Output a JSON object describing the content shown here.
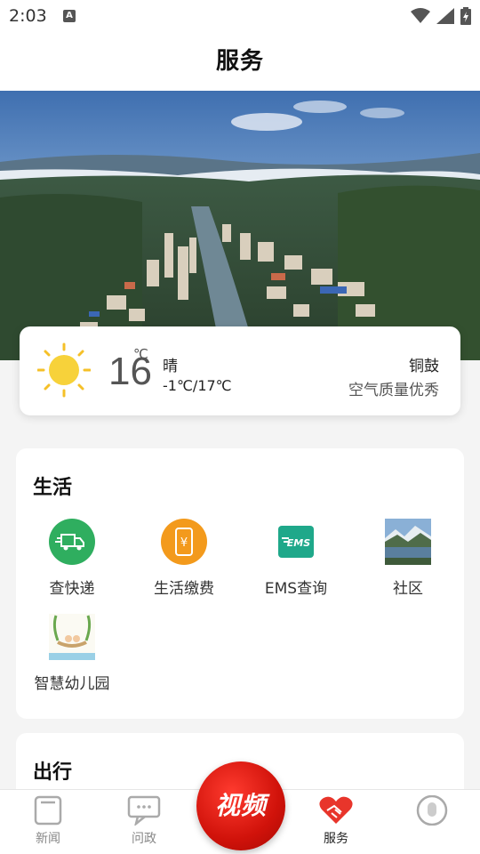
{
  "status": {
    "time": "2:03",
    "badge": "A"
  },
  "header": {
    "title": "服务"
  },
  "weather": {
    "temperature": "16",
    "unit": "℃",
    "condition": "晴",
    "range": "-1℃/17℃",
    "city": "铜鼓",
    "air_quality": "空气质量优秀",
    "icon": "sun-icon"
  },
  "life": {
    "title": "生活",
    "items": [
      {
        "label": "查快递",
        "icon": "truck-icon",
        "color": "#2fae5f"
      },
      {
        "label": "生活缴费",
        "icon": "payment-icon",
        "color": "#f39a1c"
      },
      {
        "label": "EMS查询",
        "icon": "ems-icon",
        "color": "#1fa88a",
        "logo_text": "EMS"
      },
      {
        "label": "社区",
        "icon": "community-photo-icon"
      },
      {
        "label": "智慧幼儿园",
        "icon": "kindergarten-icon"
      }
    ]
  },
  "travel": {
    "title": "出行"
  },
  "tabbar": {
    "items": [
      {
        "label": "新闻",
        "icon": "news-icon"
      },
      {
        "label": "问政",
        "icon": "chat-icon"
      },
      {
        "label": "视频",
        "icon": "video-icon"
      },
      {
        "label": "服务",
        "icon": "handshake-heart-icon",
        "active": true
      },
      {
        "label": "",
        "icon": "profile-icon"
      }
    ],
    "accent": "#e8352b"
  }
}
